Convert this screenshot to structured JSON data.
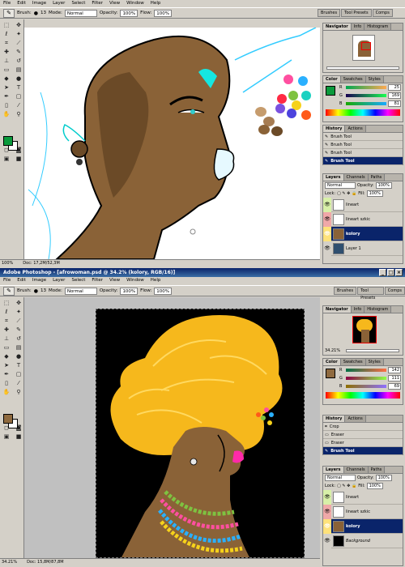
{
  "window1": {
    "menus": [
      "File",
      "Edit",
      "Image",
      "Layer",
      "Select",
      "Filter",
      "View",
      "Window",
      "Help"
    ],
    "options": {
      "brush_label": "Brush:",
      "brush_size": "13",
      "mode_label": "Mode:",
      "mode_value": "Normal",
      "opacity_label": "Opacity:",
      "opacity_value": "100%",
      "flow_label": "Flow:",
      "flow_value": "100%"
    },
    "palette_well": [
      "Brushes",
      "Tool Presets",
      "Comps"
    ],
    "status": {
      "zoom": "100%",
      "doc": "Doc: 17,2M/52,3M"
    },
    "navigator_tabs": [
      "Navigator",
      "Info",
      "Histogram"
    ],
    "color_tabs": [
      "Color",
      "Swatches",
      "Styles"
    ],
    "color": {
      "fg": "#0a9a3c",
      "r": "25",
      "g": "169",
      "b": "81"
    },
    "history_tabs": [
      "History",
      "Actions"
    ],
    "history": [
      "Brush Tool",
      "Brush Tool",
      "Brush Tool",
      "Brush Tool"
    ],
    "layers_tabs": [
      "Layers",
      "Channels",
      "Paths"
    ],
    "layer_mode": "Normal",
    "opacity_label": "Opacity:",
    "opacity_value": "100%",
    "lock_label": "Lock:",
    "fill_label": "Fill:",
    "fill_value": "100%",
    "layers": [
      {
        "name": "lineart",
        "sel": false
      },
      {
        "name": "lineart szkic",
        "sel": false
      },
      {
        "name": "kolory",
        "sel": true
      },
      {
        "name": "Layer 1",
        "sel": false
      }
    ]
  },
  "window2": {
    "title": "Adobe Photoshop - [afrowoman.psd @ 34.2% (kolory, RGB/16)]",
    "menus": [
      "File",
      "Edit",
      "Image",
      "Layer",
      "Select",
      "Filter",
      "View",
      "Window",
      "Help"
    ],
    "options": {
      "brush_label": "Brush:",
      "brush_size": "13",
      "mode_label": "Mode:",
      "mode_value": "Normal",
      "opacity_label": "Opacity:",
      "opacity_value": "100%",
      "flow_label": "Flow:",
      "flow_value": "100%"
    },
    "palette_well": [
      "Brushes",
      "Tool Presets",
      "Comps"
    ],
    "status": {
      "zoom": "34.21%",
      "doc": "Doc: 15,8M/87,8M"
    },
    "navigator_tabs": [
      "Navigator",
      "Info",
      "Histogram"
    ],
    "nav_zoom": "34.21%",
    "color_tabs": [
      "Color",
      "Swatches",
      "Styles"
    ],
    "color": {
      "fg": "#8f6a3f",
      "r": "142",
      "g": "111",
      "b": "69"
    },
    "history_tabs": [
      "History",
      "Actions"
    ],
    "history": [
      "Crop",
      "Eraser",
      "Eraser",
      "Brush Tool"
    ],
    "layers_tabs": [
      "Layers",
      "Channels",
      "Paths"
    ],
    "layer_mode": "Normal",
    "opacity_label": "Opacity:",
    "opacity_value": "100%",
    "lock_label": "Lock:",
    "fill_label": "Fill:",
    "fill_value": "100%",
    "layers": [
      {
        "name": "lineart",
        "sel": false
      },
      {
        "name": "lineart szkic",
        "sel": false
      },
      {
        "name": "kolory",
        "sel": true
      },
      {
        "name": "Background",
        "sel": false
      }
    ]
  }
}
